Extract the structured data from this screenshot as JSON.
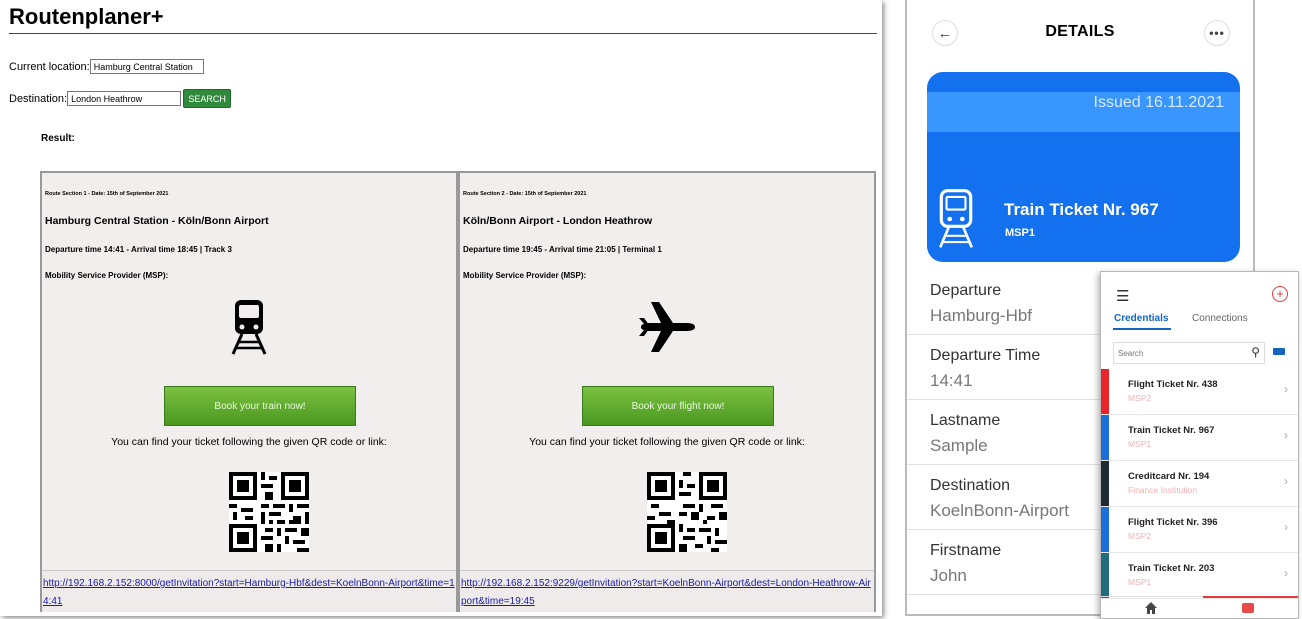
{
  "web": {
    "title": "Routenplaner+",
    "location_label": "Current location:",
    "location_value": "Hamburg Central Station",
    "destination_label": "Destination:",
    "destination_value": "London Heathrow",
    "search_label": "SEARCH",
    "result_label": "Result:",
    "sections": [
      {
        "date": "Route Section 1 - Date: 15th of September 2021",
        "route": "Hamburg Central Station - Köln/Bonn Airport",
        "times": "Departure time 14:41 - Arrival time 18:45 | Track 3",
        "msp": "Mobility Service Provider (MSP):",
        "icon": "train-icon",
        "book_label": "Book your train now!",
        "hint": "You can find your ticket following the given QR code or link:",
        "link": "http://192.168.2.152:8000/getInvitation?start=Hamburg-Hbf&dest=KoelnBonn-Airport&time=14:41"
      },
      {
        "date": "Route Section 2 - Date: 15th of September 2021",
        "route": "Köln/Bonn Airport - London Heathrow",
        "times": "Departure time 19:45 - Arrival time 21:05 | Terminal 1",
        "msp": "Mobility Service Provider (MSP):",
        "icon": "airplane-icon",
        "book_label": "Book your flight now!",
        "hint": "You can find your ticket following the given QR code or link:",
        "link": "http://192.168.2.152:9229/getInvitation?start=KoelnBonn-Airport&dest=London-Heathrow-Airport&time=19:45"
      }
    ]
  },
  "details": {
    "title": "DETAILS",
    "back_icon": "arrow-left-icon",
    "more_icon": "more-horizontal-icon",
    "ticket": {
      "issued": "Issued 16.11.2021",
      "name": "Train Ticket Nr. 967",
      "msp": "MSP1",
      "color": "#1371f0"
    },
    "fields": [
      {
        "label": "Departure",
        "value": "Hamburg-Hbf"
      },
      {
        "label": "Departure Time",
        "value": "14:41"
      },
      {
        "label": "Lastname",
        "value": "Sample"
      },
      {
        "label": "Destination",
        "value": "KoelnBonn-Airport"
      },
      {
        "label": "Firstname",
        "value": "John"
      }
    ]
  },
  "wallet": {
    "tabs": [
      "Credentials",
      "Connections"
    ],
    "search_placeholder": "Search",
    "items": [
      {
        "name": "Flight Ticket Nr. 438",
        "sub": "MSP2",
        "color": "#e8252a"
      },
      {
        "name": "Train Ticket Nr. 967",
        "sub": "MSP1",
        "color": "#1c6fd8"
      },
      {
        "name": "Creditcard Nr. 194",
        "sub": "Finance Institution",
        "color": "#1e2b33"
      },
      {
        "name": "Flight Ticket Nr. 396",
        "sub": "MSP2",
        "color": "#1c6fd8"
      },
      {
        "name": "Train Ticket Nr. 203",
        "sub": "MSP1",
        "color": "#1f6c7c"
      }
    ],
    "nav": [
      "home-icon",
      "wallet-icon"
    ]
  }
}
